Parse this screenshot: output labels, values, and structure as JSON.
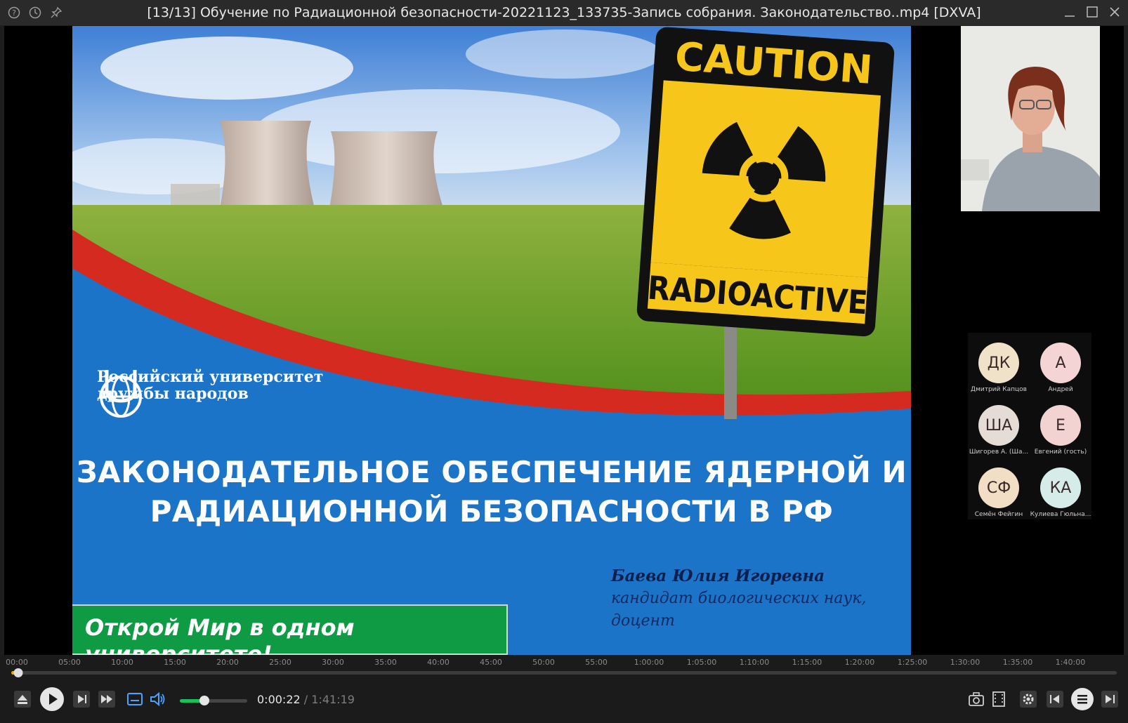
{
  "window": {
    "title": "[13/13] Обучение по Радиационной безопасности-20221123_133735-Запись собрания. Законодательство..mp4 [DXVA]",
    "left_icons": [
      "help-icon",
      "history-icon",
      "pin-icon"
    ],
    "controls": [
      "minimize-icon",
      "maximize-icon",
      "close-icon"
    ]
  },
  "slide": {
    "sign_top": "CAUTION",
    "sign_bottom": "RADIOACTIVE",
    "university_line1": "Российский университет",
    "university_line2": "дружбы народов",
    "headline_line1": "ЗАКОНОДАТЕЛЬНОЕ ОБЕСПЕЧЕНИЕ ЯДЕРНОЙ И",
    "headline_line2": "РАДИАЦИОННОЙ БЕЗОПАСНОСТИ В РФ",
    "author_name": "Баева Юлия Игоревна",
    "author_degree_line1": "кандидат биологических наук,",
    "author_degree_line2": "доцент",
    "banner": "Открой Мир в одном университете!"
  },
  "participants": [
    {
      "initials": "ДК",
      "name": "Дмитрий Капцов",
      "color": "#efe2c8"
    },
    {
      "initials": "А",
      "name": "Андрей",
      "color": "#f4d4d4"
    },
    {
      "initials": "ША",
      "name": "Шигорев А. (Ша...",
      "color": "#e6dcd6"
    },
    {
      "initials": "Е",
      "name": "Евгений (гость)",
      "color": "#f3d2d2"
    },
    {
      "initials": "СФ",
      "name": "Семён Фейгин",
      "color": "#f2ddc5"
    },
    {
      "initials": "КА",
      "name": "Кулиева Гюльна...",
      "color": "#d6ece8"
    }
  ],
  "player": {
    "ticks": [
      "00:00",
      "05:00",
      "10:00",
      "15:00",
      "20:00",
      "25:00",
      "30:00",
      "35:00",
      "40:00",
      "45:00",
      "50:00",
      "55:00",
      "1:00:00",
      "1:05:00",
      "1:10:00",
      "1:15:00",
      "1:20:00",
      "1:25:00",
      "1:30:00",
      "1:35:00",
      "1:40:00"
    ],
    "current_time": "0:00:22",
    "separator": "/",
    "total_time": "1:41:19",
    "progress_fraction": 0.0036,
    "volume_fraction": 0.36,
    "seek_color": "#f0a800",
    "volume_color": "#19c15a"
  }
}
